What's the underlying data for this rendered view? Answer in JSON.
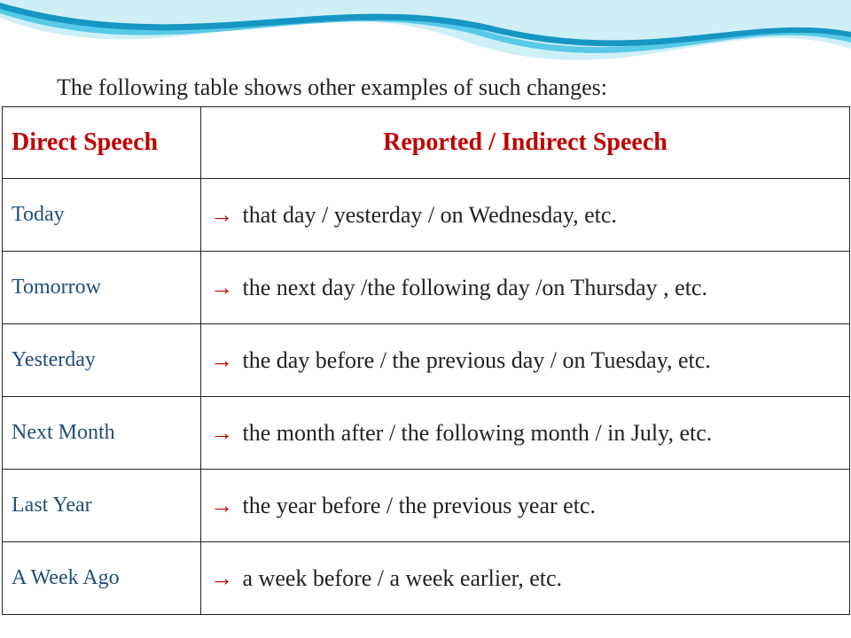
{
  "intro": "The following table shows other examples of such changes:",
  "headers": {
    "direct": "Direct Speech",
    "reported": "Reported / Indirect Speech"
  },
  "arrow": "→",
  "rows": [
    {
      "direct": "Today",
      "reported": " that day / yesterday / on Wednesday, etc."
    },
    {
      "direct": "Tomorrow",
      "reported": " the next day /the following day /on Thursday , etc."
    },
    {
      "direct": "Yesterday",
      "reported": " the day before / the previous day / on Tuesday, etc."
    },
    {
      "direct": "Next Month",
      "reported": " the month after / the following month / in July, etc."
    },
    {
      "direct": "Last Year",
      "reported": " the year before / the previous year etc."
    },
    {
      "direct": "A Week Ago",
      "reported": " a week before / a week earlier, etc."
    }
  ],
  "colors": {
    "accent_red": "#c00000",
    "accent_blue": "#1f4e79",
    "wave_light": "#cfeff7",
    "wave_mid": "#58c9e8",
    "wave_dark": "#1796c4"
  }
}
